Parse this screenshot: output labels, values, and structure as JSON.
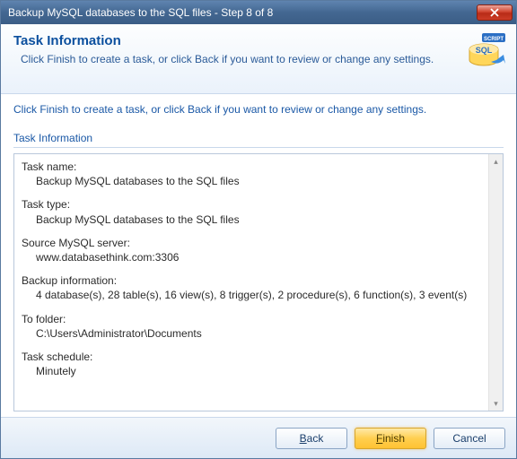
{
  "window": {
    "title": "Backup MySQL databases to the SQL files - Step 8 of 8"
  },
  "header": {
    "title": "Task Information",
    "subtitle": "Click Finish to create a task, or click Back if you want to review or change any settings.",
    "icon_badge": "SCRIPT",
    "icon_label": "SQL"
  },
  "content": {
    "instruction": "Click Finish to create a task, or click Back if you want to review or change any settings.",
    "section_label": "Task Information",
    "summary": {
      "task_name_label": "Task name:",
      "task_name_value": "Backup MySQL databases to the SQL files",
      "task_type_label": "Task type:",
      "task_type_value": "Backup MySQL databases to the SQL files",
      "source_label": "Source MySQL server:",
      "source_value": "www.databasethink.com:3306",
      "backup_info_label": "Backup information:",
      "backup_info_value": "4 database(s), 28 table(s), 16 view(s), 8 trigger(s), 2 procedure(s), 6 function(s), 3 event(s)",
      "to_folder_label": "To folder:",
      "to_folder_value": "C:\\Users\\Administrator\\Documents",
      "schedule_label": "Task schedule:",
      "schedule_value": "Minutely"
    }
  },
  "footer": {
    "back": "Back",
    "finish": "Finish",
    "cancel": "Cancel"
  }
}
